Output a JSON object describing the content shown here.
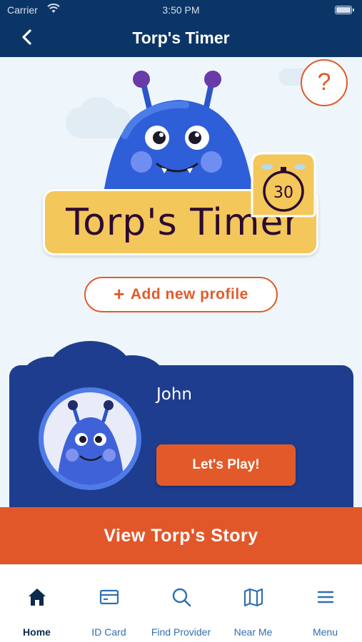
{
  "status": {
    "carrier": "Carrier",
    "time": "3:50 PM"
  },
  "header": {
    "title": "Torp's Timer"
  },
  "hero": {
    "help_label": "?",
    "banner_text": "Torp's Timer",
    "timer_number": "30",
    "add_profile_label": "Add new profile"
  },
  "profile": {
    "name": "John",
    "play_label": "Let's Play!"
  },
  "story": {
    "label": "View Torp's Story"
  },
  "tabs": [
    {
      "label": "Home",
      "icon": "home-icon",
      "active": true
    },
    {
      "label": "ID Card",
      "icon": "id-card-icon"
    },
    {
      "label": "Find Provider",
      "icon": "search-icon"
    },
    {
      "label": "Near Me",
      "icon": "map-icon"
    },
    {
      "label": "Menu",
      "icon": "menu-icon"
    }
  ],
  "colors": {
    "navy": "#0b3566",
    "orange": "#e25a2a",
    "card": "#1f3d8f",
    "banner": "#f3c75a"
  }
}
